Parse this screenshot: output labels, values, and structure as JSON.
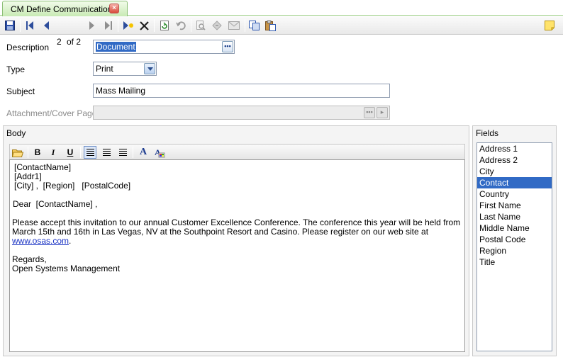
{
  "tab": {
    "title": "CM Define Communications"
  },
  "toolbar": {
    "record_current": "2",
    "record_of": "of 2"
  },
  "form": {
    "description": {
      "label": "Description",
      "value": "Document"
    },
    "type": {
      "label": "Type",
      "value": "Print"
    },
    "subject": {
      "label": "Subject",
      "value": "Mass Mailing"
    },
    "attachment": {
      "label": "Attachment/Cover Page",
      "value": ""
    }
  },
  "body_group": {
    "title": "Body",
    "content": {
      "line1": "[ContactName]",
      "line2": "[Addr1]",
      "line3": "[City] ,  [Region]   [PostalCode]",
      "greeting": "Dear  [ContactName] ,",
      "paragraph": "Please accept this invitation to our annual Customer Excellence Conference. The conference this year will be held from March 15th and 16th in Las Vegas, NV at the Southpoint Resort and Casino. Please register on our web site at ",
      "link": "www.osas.com",
      "period": ".",
      "regards": "Regards,",
      "signature": "Open Systems Management"
    }
  },
  "fields_group": {
    "title": "Fields",
    "items": [
      "Address 1",
      "Address 2",
      "City",
      "Contact",
      "Country",
      "First Name",
      "Last Name",
      "Middle Name",
      "Postal Code",
      "Region",
      "Title"
    ],
    "selected": "Contact"
  },
  "colors": {
    "selection": "#316ac5",
    "tab_green": "#c8eab4",
    "link": "#1a33c4"
  }
}
